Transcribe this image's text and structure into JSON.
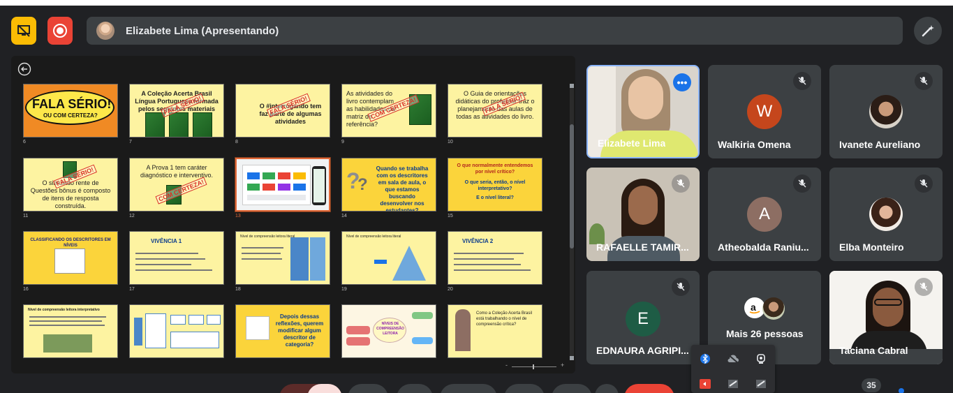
{
  "presenter_bar": {
    "name": "Elizabete Lima (Apresentando)"
  },
  "slides": {
    "numbers": [
      "6",
      "7",
      "8",
      "9",
      "10",
      "11",
      "12",
      "13",
      "14",
      "15",
      "16",
      "17",
      "18",
      "19",
      "20",
      "21",
      "22",
      "23",
      "24",
      "25"
    ],
    "s6": {
      "line1": "FALA SÉRIO!",
      "line2": "OU COM CERTEZA?"
    },
    "s7": {
      "text": "A Coleção Acerta Brasil Língua Portuguesa formada pelos seguintes materiais",
      "stamp": "FALA SÉRIO!"
    },
    "s8": {
      "text": "O #interrogando tem faz parte de algumas atividades",
      "stamp": "FALA SÉRIO!"
    },
    "s9": {
      "text": "As atividades do livro contemplam as habilidades da matriz de referência?",
      "stamp": "COM CERTEZA!"
    },
    "s10": {
      "text": "O Guia de orientações didáticas do professor traz o planejamento das aulas de todas as atividades do livro.",
      "stamp": "FALA SÉRIO!"
    },
    "s11": {
      "text": "O simulado rente de Questões bônus é composto de itens de resposta construída.",
      "stamp": "FALA SÉRIO!"
    },
    "s12": {
      "text": "A Prova 1 tem caráter diagnóstico e interventivo.",
      "stamp": "COM CERTEZA!"
    },
    "s14": {
      "text": "Quando se trabalha com os descritores em sala de aula, o que estamos buscando desenvolver nos estudantes?"
    },
    "s15": {
      "line1": "O que normalmente entendemos por nível crítico?",
      "line2": "O que seria, então, o nível interpretativo?",
      "line3": "E o nível literal?"
    },
    "s16": {
      "text": "CLASSIFICANDO OS DESCRITORES EM NÍVEIS"
    },
    "s17": {
      "text": "VIVÊNCIA 1"
    },
    "s18": {
      "text": "Nível de compreensão leitora literal"
    },
    "s19": {
      "text": "Nível de compreensão leitora literal"
    },
    "s20": {
      "text": "VIVÊNCIA 2"
    },
    "s21": {
      "text": "Nível de compreensão leitora interpretativo"
    },
    "s23": {
      "text": "Depois dessas reflexões, querem modificar algum descritor de categoria?"
    },
    "s24": {
      "text": "NÍVEIS DE COMPREENSÃO LEITORA"
    },
    "s25": {
      "text": "Como a Coleção Acerta Brasil está trabalhando o nível de compreensão crítica?"
    }
  },
  "zoom": {
    "minus": "-",
    "plus": "+"
  },
  "participants": [
    {
      "name": "Elizabete Lima"
    },
    {
      "name": "Walkiria Omena",
      "initial": "W",
      "color": "#c5461c"
    },
    {
      "name": "Ivanete Aureliano"
    },
    {
      "name": "RAFAELLE TAMIR..."
    },
    {
      "name": "Atheobalda Raniu...",
      "initial": "A",
      "color": "#8d6e63"
    },
    {
      "name": "Elba Monteiro"
    },
    {
      "name": "EDNAURA AGRIPI...",
      "initial": "E",
      "color": "#1e5c45"
    },
    {
      "name": "Mais 26 pessoas"
    },
    {
      "name": "Taciana Cabral"
    }
  ],
  "people_count": "35",
  "colors": {
    "accent": "#8ab4f8",
    "present": "#fbbc04",
    "record": "#ea4335"
  }
}
